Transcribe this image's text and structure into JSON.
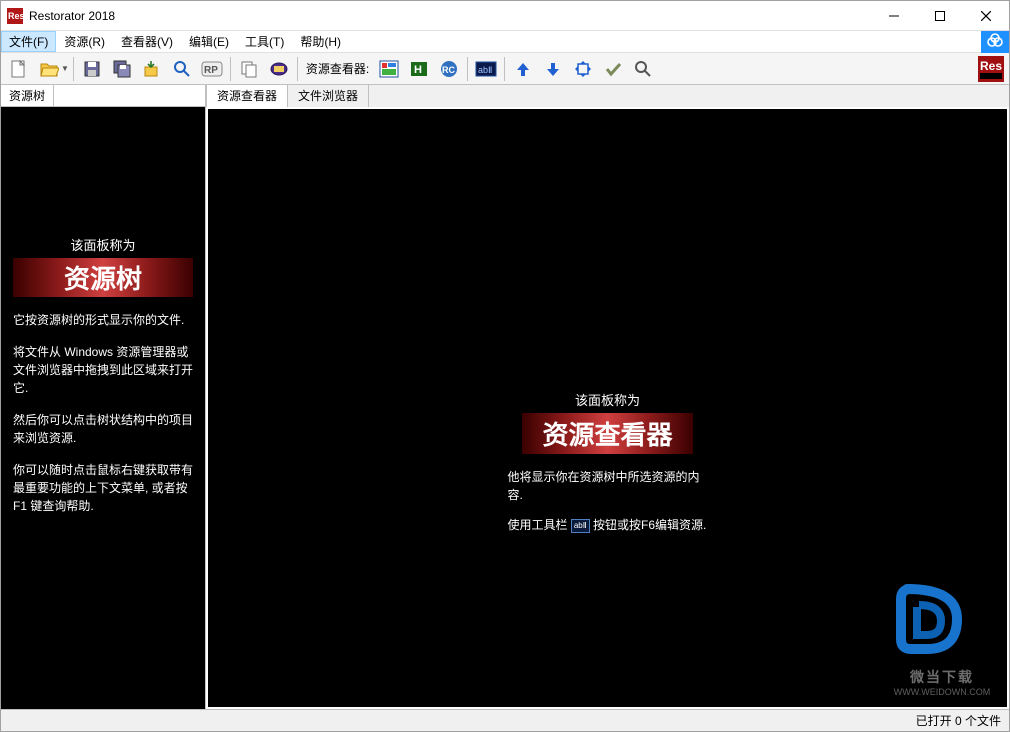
{
  "title": "Restorator 2018",
  "menus": {
    "file": "文件(F)",
    "resource": "资源(R)",
    "viewer": "查看器(V)",
    "edit": "编辑(E)",
    "tools": "工具(T)",
    "help": "帮助(H)"
  },
  "toolbar": {
    "viewer_label": "资源查看器:"
  },
  "left_panel": {
    "tab": "资源树",
    "header_small": "该面板称为",
    "header_big": "资源树",
    "para1": "它按资源树的形式显示你的文件.",
    "para2": "将文件从 Windows 资源管理器或文件浏览器中拖拽到此区域来打开它.",
    "para3": "然后你可以点击树状结构中的项目来浏览资源.",
    "para4": "你可以随时点击鼠标右键获取带有最重要功能的上下文菜单, 或者按 F1 键查询帮助."
  },
  "right_panel": {
    "tab1": "资源查看器",
    "tab2": "文件浏览器",
    "header_small": "该面板称为",
    "header_big": "资源查看器",
    "para1": "他将显示你在资源树中所选资源的内容.",
    "para2_a": "使用工具栏",
    "para2_b": "按钮或按F6编辑资源."
  },
  "status": "已打开 0 个文件",
  "watermark": {
    "text": "微当下载",
    "sub": "WWW.WEIDOWN.COM"
  }
}
